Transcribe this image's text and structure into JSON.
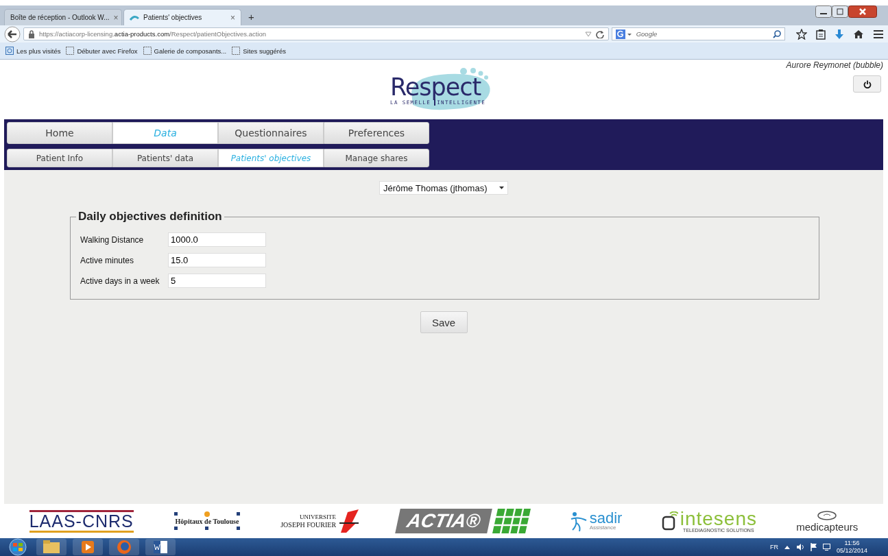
{
  "browser": {
    "tabs": [
      {
        "label": "Boîte de réception - Outlook W...",
        "selected": false,
        "close": "×"
      },
      {
        "label": "Patients' objectives",
        "selected": true,
        "close": "×"
      }
    ],
    "new_tab": "+",
    "url": {
      "prefix": "https://actiacorp-licensing.",
      "domain": "actia-products.com",
      "path": "/Respect/patientObjectives.action"
    },
    "search": {
      "placeholder": "Google"
    },
    "bookmarks": [
      "Les plus visités",
      "Débuter avec Firefox",
      "Galerie de composants...",
      "Sites suggérés"
    ]
  },
  "header": {
    "logo": {
      "title": "Respect",
      "tagline_1": "LA SEMELLE",
      "tagline_2": "INTELLIGENTE"
    },
    "user": "Aurore Reymonet (bubble)"
  },
  "main_tabs": [
    {
      "label": "Home",
      "selected": false
    },
    {
      "label": "Data",
      "selected": true
    },
    {
      "label": "Questionnaires",
      "selected": false
    },
    {
      "label": "Preferences",
      "selected": false
    }
  ],
  "sub_tabs": [
    {
      "label": "Patient Info",
      "selected": false
    },
    {
      "label": "Patients' data",
      "selected": false
    },
    {
      "label": "Patients' objectives",
      "selected": true
    },
    {
      "label": "Manage shares",
      "selected": false
    }
  ],
  "patient_select": "Jérôme Thomas (jthomas)",
  "objectives": {
    "legend": "Daily objectives definition",
    "fields": [
      {
        "label": "Walking Distance",
        "value": "1000.0"
      },
      {
        "label": "Active minutes",
        "value": "15.0"
      },
      {
        "label": "Active days in a week",
        "value": "5"
      }
    ]
  },
  "save": "Save",
  "partners": [
    {
      "kind": "laas",
      "text": "LAAS-CNRS"
    },
    {
      "kind": "chu",
      "text": "Hôpitaux de Toulouse"
    },
    {
      "kind": "ujf",
      "text": "UNIVERSITE",
      "text_2": "JOSEPH FOURIER"
    },
    {
      "kind": "actia",
      "text": "ACTIA®"
    },
    {
      "kind": "sadir",
      "text": "sadir",
      "text_2": "Assistance"
    },
    {
      "kind": "intesens",
      "text": "intesens",
      "text_2": "TELEDIAGNOSTIC SOLUTIONS"
    },
    {
      "kind": "medi",
      "text": "medicapteurs"
    }
  ],
  "taskbar": {
    "lang": "FR",
    "time": "11:56",
    "date": "05/12/2014"
  }
}
